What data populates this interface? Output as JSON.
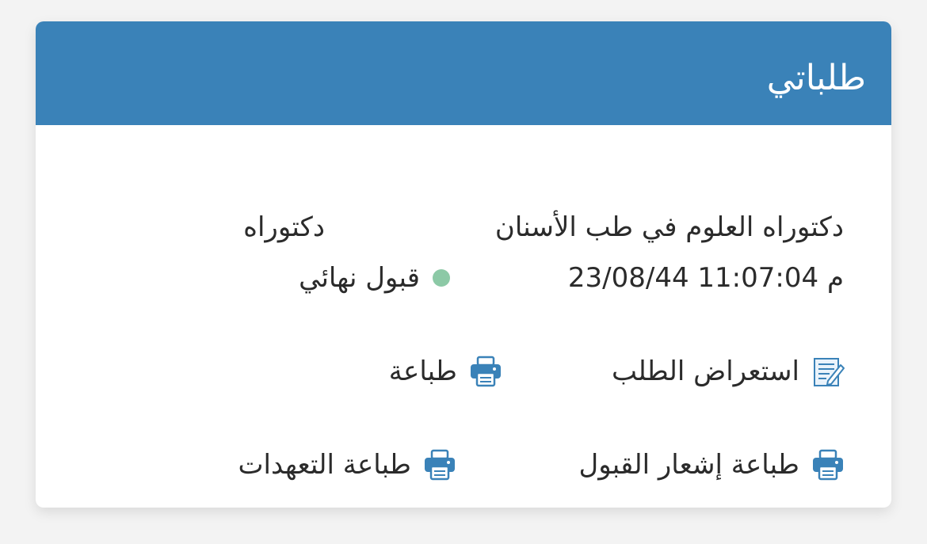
{
  "card": {
    "title": "طلباتي"
  },
  "application": {
    "program": "دكتوراه العلوم في طب الأسنان",
    "degree": "دكتوراه",
    "datetime": "23/08/44 11:07:04 م",
    "status": "قبول نهائي",
    "status_color": "#8cc9a6"
  },
  "actions": {
    "view_label": "استعراض الطلب",
    "print_label": "طباعة",
    "print_acceptance_label": "طباعة إشعار القبول",
    "print_pledges_label": "طباعة التعهدات"
  },
  "colors": {
    "header": "#3a82b8",
    "icon": "#3a82b8"
  },
  "icons": {
    "view": "edit-document-icon",
    "print": "printer-icon"
  }
}
